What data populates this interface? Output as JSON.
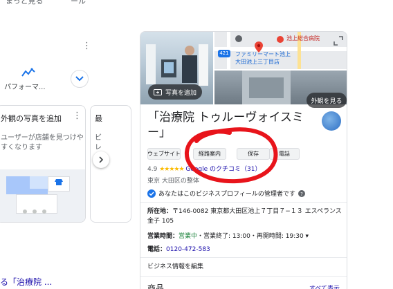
{
  "top_strip": {
    "left_text": "まっと見る",
    "right_text": "ール"
  },
  "left": {
    "performance_label": "パフォーマ...",
    "card1": {
      "title": "外観の写真を追加",
      "body_line1": "ユーザーが店舗を見つけや",
      "body_line2": "すくなります"
    },
    "card2": {
      "title": "最",
      "body_line1": "ビ",
      "body_line2": "レ"
    },
    "bottom_link": "る「治療院 ..."
  },
  "panel": {
    "map_labels": {
      "hospital": "池上総合病院",
      "route": "421",
      "store_line1": "ファミリーマート池上",
      "store_line2": "大田池上三丁目店"
    },
    "add_photo_label": "写真を追加",
    "exterior_label": "外観を見る",
    "title": "「治療院 トゥルーヴォイスミー」",
    "actions": [
      "ウェブサイト",
      "経路案内",
      "保存",
      "電話"
    ],
    "rating": "4.9",
    "stars": "★★★★★",
    "reviews_link": "Google のクチコミ（31）",
    "category": "東京 大田区の整体",
    "owner_text": "あなたはこのビジネスプロフィールの管理者です",
    "address_label": "所在地：",
    "address_value": "〒146-0082 東京都大田区池上７丁目７−１３ エスペランス金子 105",
    "hours_label": "営業時間：",
    "hours_open": "営業中",
    "hours_rest": "・営業終了: 13:00・再開時間: 19:30 ▾",
    "phone_label": "電話：",
    "phone_value": "0120-472-583",
    "edit_link": "ビジネス情報を編集",
    "products_label": "商品",
    "see_all": "すべて表示"
  },
  "colors": {
    "accent": "#1a73e8",
    "link": "#1a0dab",
    "annotation": "#e8141b",
    "open": "#188038"
  }
}
